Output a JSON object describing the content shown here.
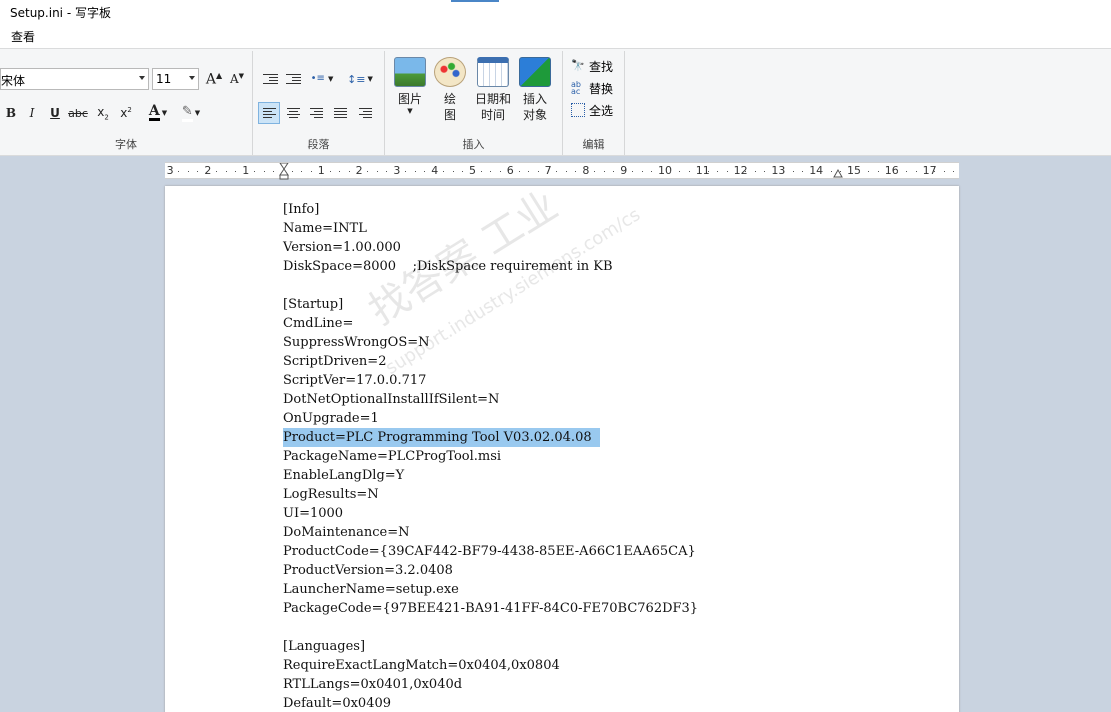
{
  "window": {
    "title": "Setup.ini - 写字板"
  },
  "menu": {
    "view": "查看"
  },
  "font": {
    "name": "宋体",
    "size": "11",
    "group_label": "字体"
  },
  "paragraph": {
    "group_label": "段落"
  },
  "insert": {
    "group_label": "插入",
    "picture": "图片",
    "paint_l1": "绘",
    "paint_l2": "图",
    "datetime_l1": "日期和",
    "datetime_l2": "时间",
    "object_l1": "插入",
    "object_l2": "对象"
  },
  "edit": {
    "group_label": "编辑",
    "find": "查找",
    "replace": "替换",
    "select_all": "全选"
  },
  "ruler": {
    "labels": [
      "3",
      "2",
      "1",
      "1",
      "2",
      "3",
      "4",
      "5",
      "6",
      "7",
      "8",
      "9",
      "10",
      "11",
      "12",
      "13",
      "14",
      "15",
      "16",
      "17"
    ]
  },
  "document": {
    "lines": [
      "[Info]",
      "Name=INTL",
      "Version=1.00.000",
      "DiskSpace=8000    ;DiskSpace requirement in KB",
      "",
      "[Startup]",
      "CmdLine=",
      "SuppressWrongOS=N",
      "ScriptDriven=2",
      "ScriptVer=17.0.0.717",
      "DotNetOptionalInstallIfSilent=N",
      "OnUpgrade=1",
      "Product=PLC Programming Tool V03.02.04.08",
      "PackageName=PLCProgTool.msi",
      "EnableLangDlg=Y",
      "LogResults=N",
      "UI=1000",
      "DoMaintenance=N",
      "ProductCode={39CAF442-BF79-4438-85EE-A66C1EAA65CA}",
      "ProductVersion=3.2.0408",
      "LauncherName=setup.exe",
      "PackageCode={97BEE421-BA91-41FF-84C0-FE70BC762DF3}",
      "",
      "[Languages]",
      "RequireExactLangMatch=0x0404,0x0804",
      "RTLLangs=0x0401,0x040d",
      "Default=0x0409"
    ],
    "selected_line": 12
  },
  "watermark": {
    "text": "找答案 工业",
    "url": "support.industry.siemens.com/cs"
  },
  "colors": {
    "selection": "#99c9ef",
    "ribbon_bg": "#f5f6f7",
    "workspace": "#c9d3e0"
  }
}
